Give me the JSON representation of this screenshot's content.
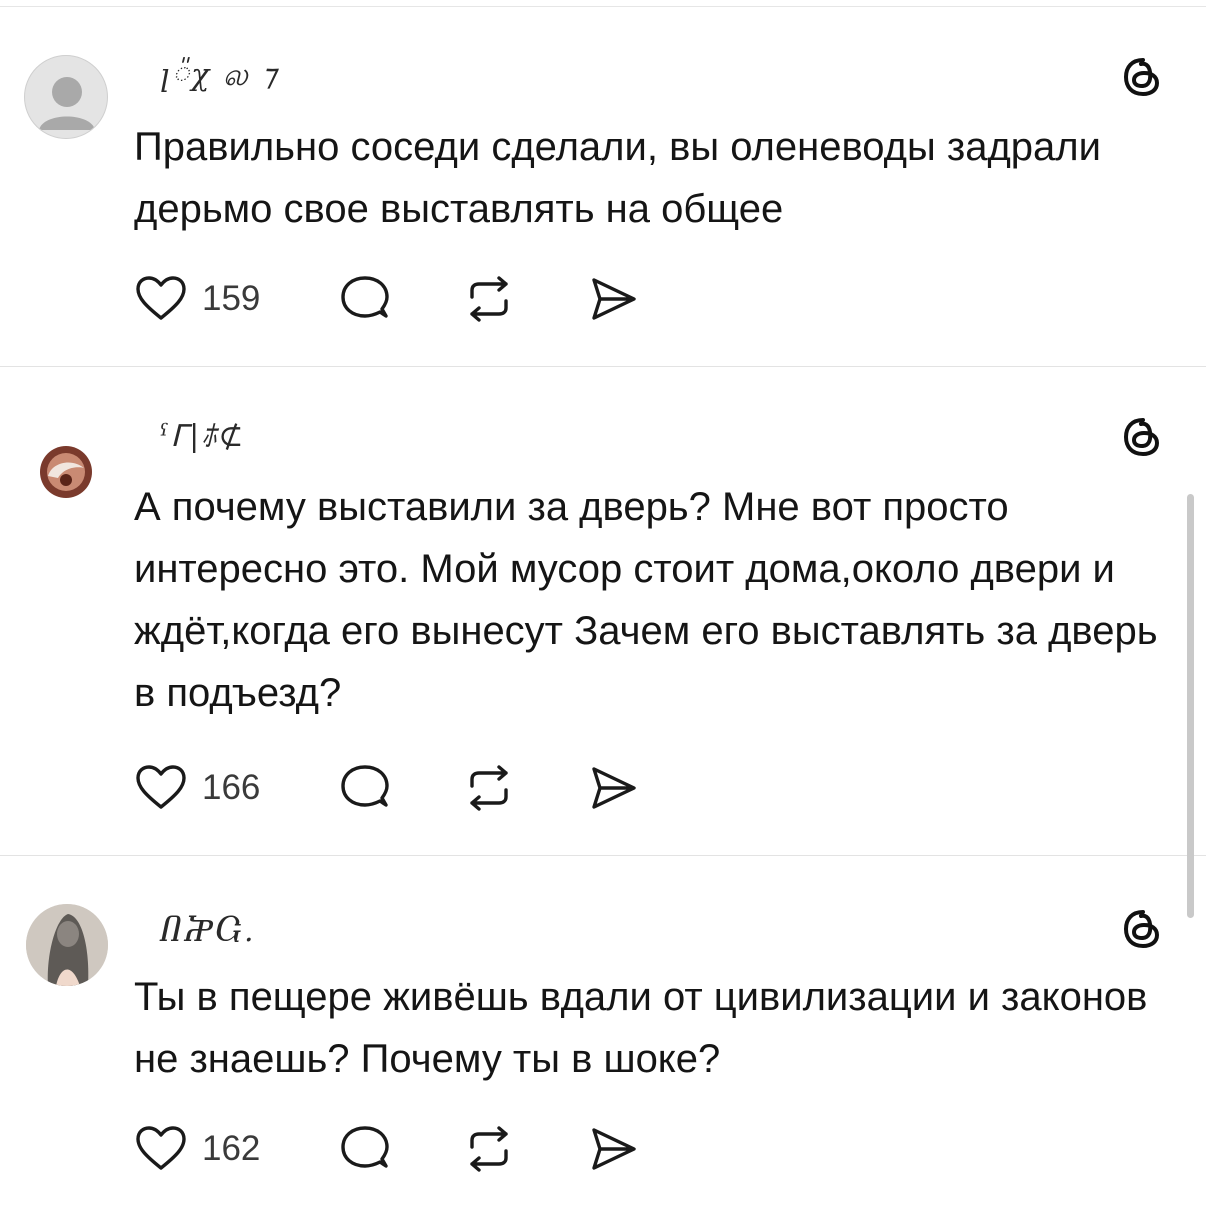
{
  "posts": [
    {
      "username": "ꞁ៉χ ல    ⁊",
      "text": "Правильно соседи сделали, вы оленеводы задрали дерьмо свое выставлять на общее",
      "likes": "159",
      "avatar": "default-avatar-icon"
    },
    {
      "username": "ˁᒥ|ﾎ⊄",
      "text": "А почему выставили за дверь? Мне вот просто интересно это.  Мой мусор стоит дома,около двери и ждёт,когда его вынесут Зачем его выставлять за дверь в подъезд?",
      "likes": "166",
      "avatar": "photo-avatar"
    },
    {
      "username": "ႶႿႺ.",
      "text": "Ты в пещере живёшь вдали от цивилизации и законов не знаешь? Почему ты в шоке?",
      "likes": "162",
      "avatar": "photo-avatar"
    }
  ],
  "icons": {
    "like": "heart-icon",
    "reply": "comment-bubble-icon",
    "repost": "repost-icon",
    "share": "send-icon",
    "brand": "threads-logo-icon"
  },
  "colors": {
    "text": "#151515",
    "icon": "#1a1a1a",
    "divider": "#e3e3e3",
    "avatar_default": "#b9b9b9"
  }
}
